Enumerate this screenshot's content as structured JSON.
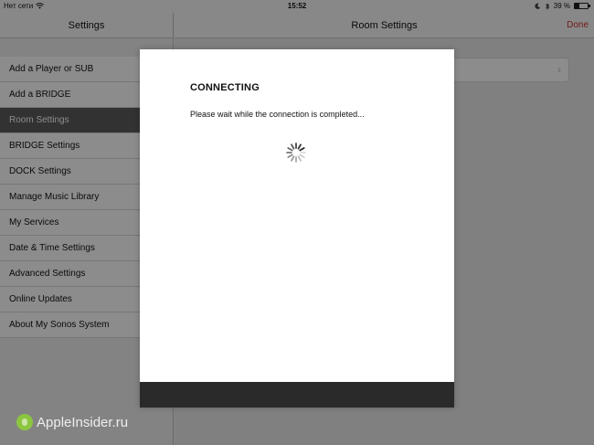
{
  "status_bar": {
    "carrier": "Нет сети",
    "time": "15:52",
    "battery_text": "39 %",
    "battery_level_percent": 39,
    "icons": [
      "wifi-icon",
      "moon-icon",
      "bluetooth-icon",
      "battery-icon"
    ]
  },
  "master": {
    "title": "Settings",
    "items": [
      {
        "label": "Add a Player or SUB"
      },
      {
        "label": "Add a BRIDGE"
      },
      {
        "label": "Room Settings",
        "selected": true
      },
      {
        "label": "BRIDGE Settings"
      },
      {
        "label": "DOCK Settings"
      },
      {
        "label": "Manage Music Library"
      },
      {
        "label": "My Services"
      },
      {
        "label": "Date & Time Settings"
      },
      {
        "label": "Advanced Settings"
      },
      {
        "label": "Online Updates"
      },
      {
        "label": "About My Sonos System"
      }
    ]
  },
  "detail": {
    "title": "Room Settings",
    "done_label": "Done"
  },
  "modal": {
    "title": "CONNECTING",
    "message": "Please wait while the connection is completed..."
  },
  "watermark": {
    "text": "AppleInsider.ru"
  },
  "colors": {
    "accent_red": "#d2322d",
    "selected_row": "#5c5c5c",
    "footer": "#2a2a2a",
    "watermark_logo": "#8cc63f"
  }
}
